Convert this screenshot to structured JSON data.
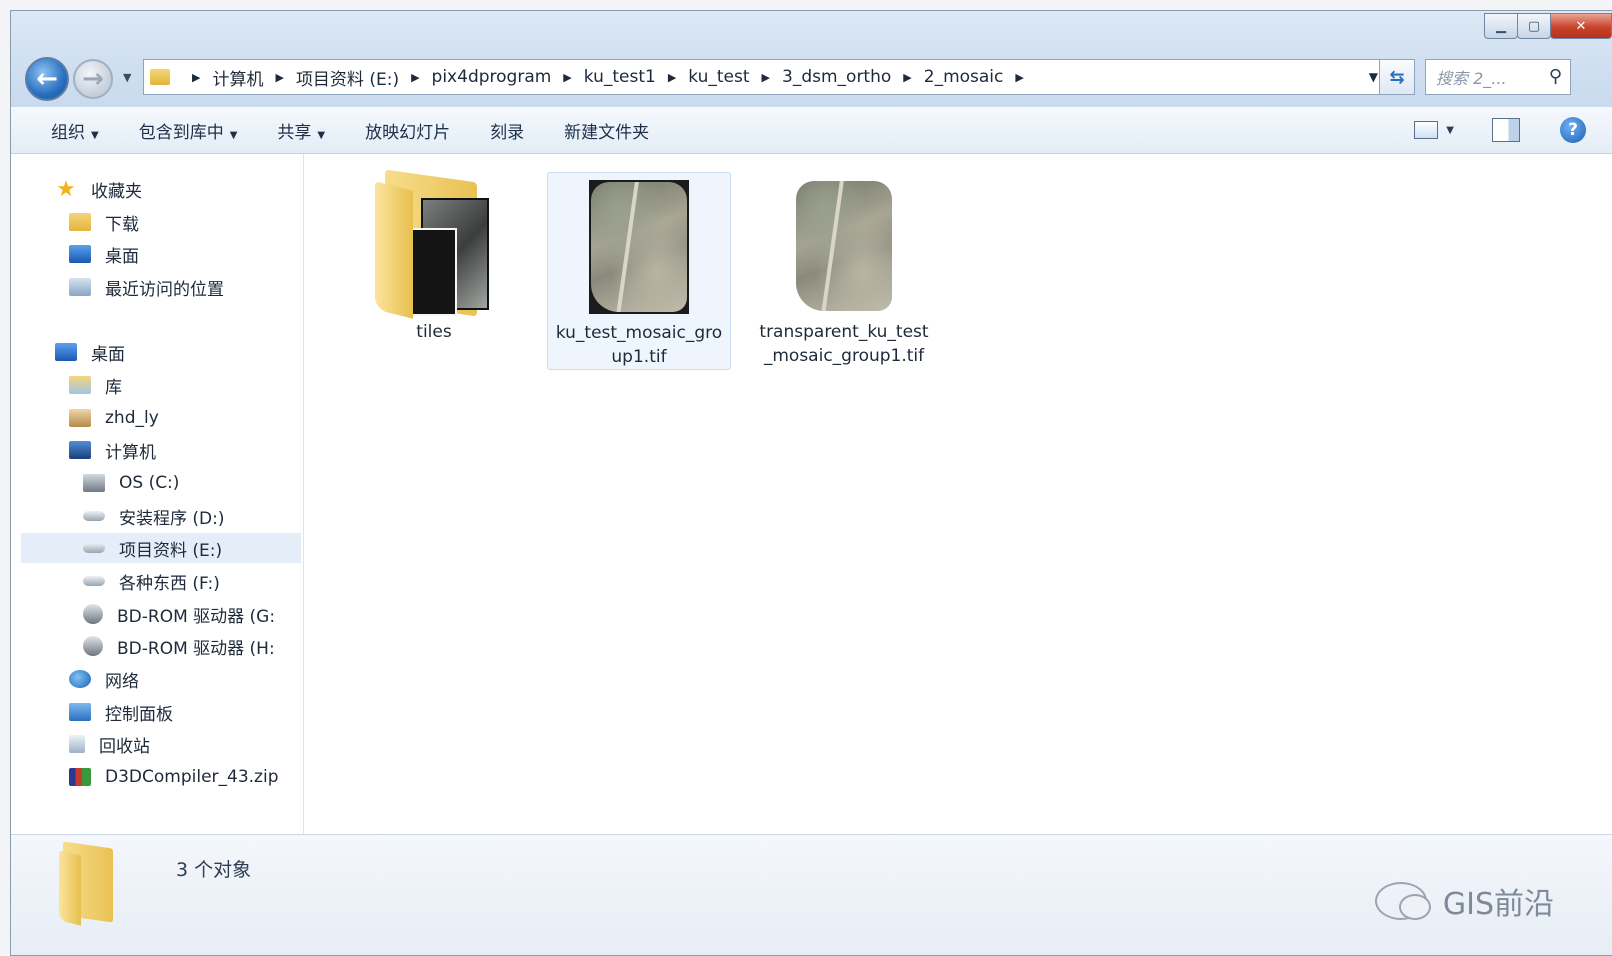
{
  "window": {
    "controls": {
      "minimize": "▁",
      "maximize": "▢",
      "close": "✕"
    }
  },
  "address": {
    "crumbs": [
      "计算机",
      "项目资料 (E:)",
      "pix4dprogram",
      "ku_test1",
      "ku_test",
      "3_dsm_ortho",
      "2_mosaic"
    ],
    "search_placeholder": "搜索 2_..."
  },
  "toolbar": {
    "organize": "组织",
    "include_library": "包含到库中",
    "share": "共享",
    "slideshow": "放映幻灯片",
    "burn": "刻录",
    "new_folder": "新建文件夹"
  },
  "nav": {
    "items": [
      {
        "label": "收藏夹",
        "icon": "star-icon"
      },
      {
        "label": "下载",
        "icon": "downloads-icon"
      },
      {
        "label": "桌面",
        "icon": "desktop-icon"
      },
      {
        "label": "最近访问的位置",
        "icon": "recent-places-icon"
      },
      {
        "label": "桌面",
        "icon": "desktop-icon"
      },
      {
        "label": "库",
        "icon": "library-icon"
      },
      {
        "label": "zhd_ly",
        "icon": "user-icon"
      },
      {
        "label": "计算机",
        "icon": "computer-icon"
      },
      {
        "label": "OS (C:)",
        "icon": "os-drive-icon"
      },
      {
        "label": "安装程序 (D:)",
        "icon": "drive-icon"
      },
      {
        "label": "项目资料 (E:)",
        "icon": "drive-icon"
      },
      {
        "label": "各种东西 (F:)",
        "icon": "drive-icon"
      },
      {
        "label": "BD-ROM 驱动器 (G:",
        "icon": "bd-rom-icon"
      },
      {
        "label": "BD-ROM 驱动器 (H:",
        "icon": "bd-rom-icon"
      },
      {
        "label": "网络",
        "icon": "network-icon"
      },
      {
        "label": "控制面板",
        "icon": "control-panel-icon"
      },
      {
        "label": "回收站",
        "icon": "recycle-bin-icon"
      },
      {
        "label": "D3DCompiler_43.zip",
        "icon": "zip-archive-icon"
      }
    ],
    "selected_index": 10
  },
  "files": [
    {
      "name": "tiles",
      "type": "folder"
    },
    {
      "name": "ku_test_mosaic_group1.tif",
      "type": "tif",
      "selected": true
    },
    {
      "name": "transparent_ku_test_mosaic_group1.tif",
      "type": "tif"
    }
  ],
  "details": {
    "count": "3 个对象"
  },
  "watermark": "GIS前沿"
}
